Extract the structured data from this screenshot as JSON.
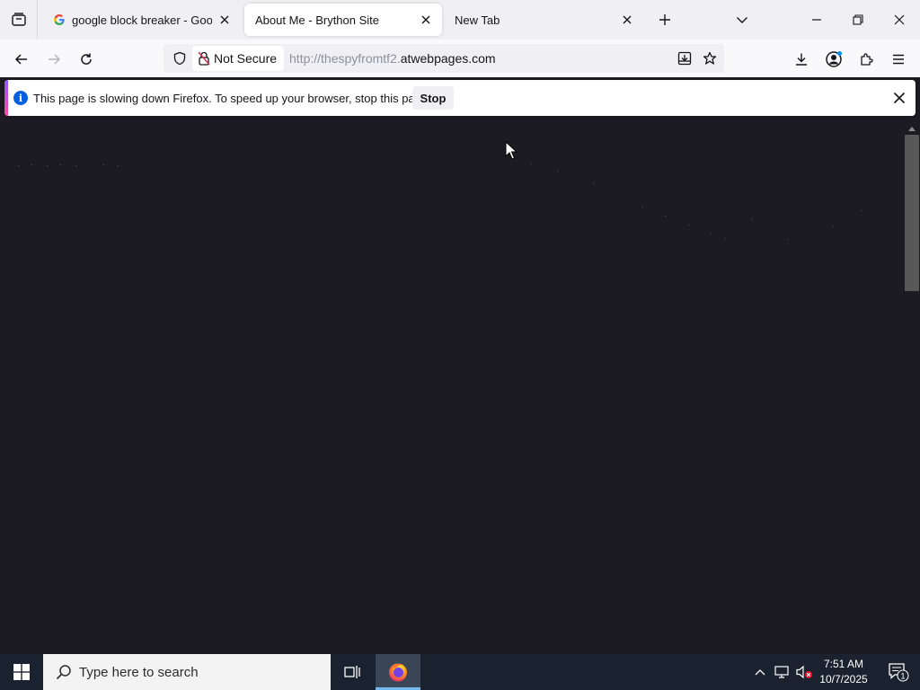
{
  "browser": {
    "tabs": [
      {
        "label": "google block breaker - Google",
        "favicon": "google-g-icon",
        "active": false
      },
      {
        "label": "About Me - Brython Site",
        "active": true
      },
      {
        "label": "New Tab",
        "active": false
      }
    ],
    "url": {
      "security_label": "Not Secure",
      "prefix": "http://thespyfromtf2.",
      "domain": "atwebpages.com"
    }
  },
  "notification": {
    "message": "This page is slowing down Firefox. To speed up your browser, stop this page.",
    "stop_label": "Stop",
    "info_glyph": "i"
  },
  "taskbar": {
    "search_placeholder": "Type here to search",
    "time": "7:51 AM",
    "date": "10/7/2025",
    "notification_count": "1"
  },
  "colors": {
    "page_background": "#1c1b22",
    "notification_accent": "#9059ff",
    "taskbar": "#1a2230",
    "info_blue": "#0060df"
  }
}
